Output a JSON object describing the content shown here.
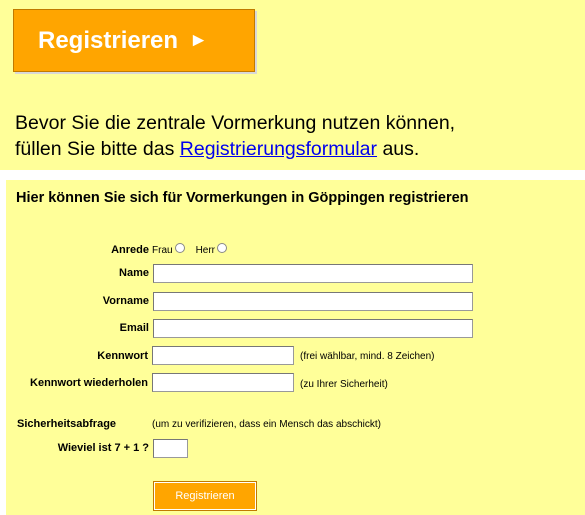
{
  "header": {
    "register_button_label": "Registrieren",
    "register_button_arrow": "►"
  },
  "intro": {
    "line1": "Bevor Sie die zentrale Vormerkung nutzen können,",
    "line2_before": "füllen Sie bitte das ",
    "link_text": "Registrierungsformular",
    "line2_after": " aus."
  },
  "form": {
    "title": "Hier können Sie sich für Vormerkungen in Göppingen registrieren",
    "salutation_label": "Anrede",
    "salutation_options": [
      "Frau",
      "Herr"
    ],
    "name_label": "Name",
    "name_value": "",
    "firstname_label": "Vorname",
    "firstname_value": "",
    "email_label": "Email",
    "email_value": "",
    "password_label": "Kennwort",
    "password_hint": "(frei wählbar, mind. 8 Zeichen)",
    "password_repeat_label": "Kennwort wiederholen",
    "password_repeat_hint": "(zu Ihrer Sicherheit)",
    "security_label": "Sicherheitsabfrage",
    "security_hint": "(um zu verifizieren, dass ein Mensch das abschickt)",
    "question_label": "Wieviel ist 7 + 1 ?",
    "answer_value": "",
    "submit_label": "Registrieren"
  },
  "colors": {
    "background_yellow": "#ffff99",
    "button_orange": "#ffa500",
    "link_blue": "#0000ee"
  }
}
